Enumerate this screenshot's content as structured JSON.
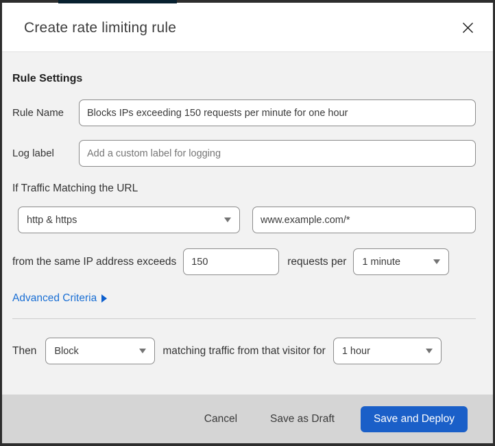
{
  "dialog": {
    "title": "Create rate limiting rule"
  },
  "form": {
    "section_heading": "Rule Settings",
    "rule_name": {
      "label": "Rule Name",
      "value": "Blocks IPs exceeding 150 requests per minute for one hour"
    },
    "log_label": {
      "label": "Log label",
      "placeholder": "Add a custom label for logging"
    },
    "traffic_match": {
      "heading": "If Traffic Matching the URL",
      "scheme_select": {
        "value": "http & https"
      },
      "url_input": {
        "value": "www.example.com/*"
      },
      "threshold": {
        "prefix": "from the same IP address exceeds",
        "requests_value": "150",
        "middle": "requests per",
        "period_select": {
          "value": "1 minute"
        }
      },
      "advanced_link": "Advanced Criteria"
    },
    "action": {
      "prefix": "Then",
      "action_select": {
        "value": "Block"
      },
      "middle": "matching traffic from that visitor for",
      "duration_select": {
        "value": "1 hour"
      }
    }
  },
  "footer": {
    "cancel_label": "Cancel",
    "save_draft_label": "Save as Draft",
    "save_deploy_label": "Save and Deploy"
  },
  "icons": {
    "close": "x-mark",
    "dropdown": "caret-down",
    "advanced_arrow": "triangle-right"
  },
  "colors": {
    "primary_button": "#1a5fc8",
    "link": "#1a6fd4",
    "top_accent": "#07202f",
    "footer_background": "#d5d5d5",
    "body_background": "#f2f2f2"
  }
}
